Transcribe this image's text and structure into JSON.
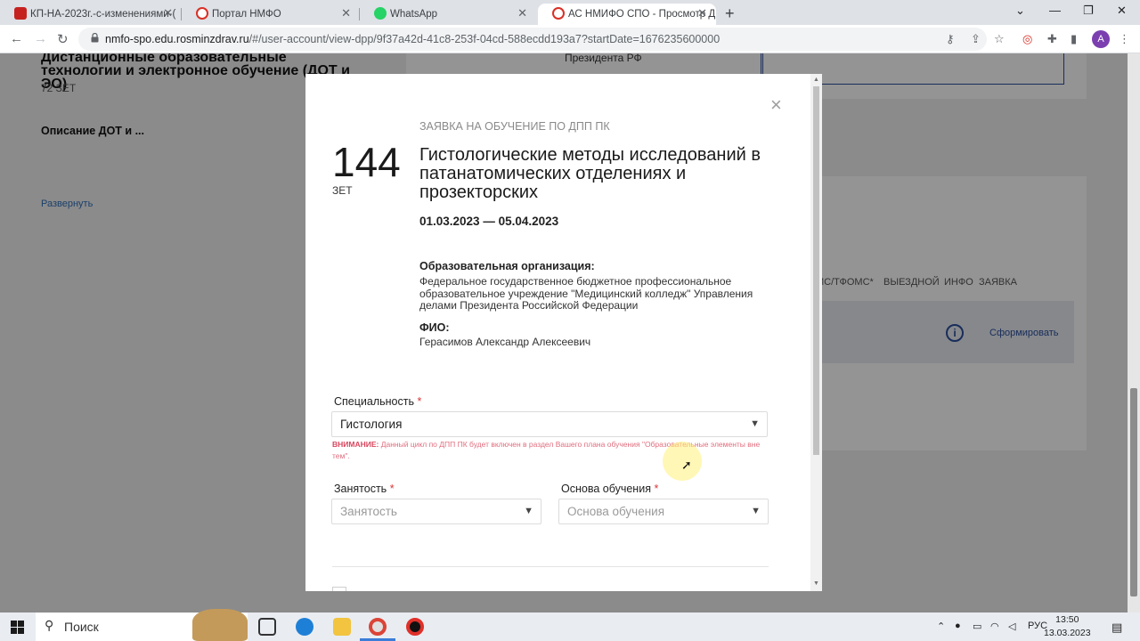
{
  "browser": {
    "tabs": [
      {
        "title": "КП-НА-2023г.-с-изменениями-(",
        "fav_color": "#c5221f"
      },
      {
        "title": "Портал НМФО",
        "fav_color": "#d93025"
      },
      {
        "title": "WhatsApp",
        "fav_color": "#25d366"
      },
      {
        "title": "АС НМИФО СПО - Просмотр Д",
        "fav_color": "#d93025"
      }
    ],
    "url_host": "nmfo-spo.edu.rosminzdrav.ru",
    "url_path": "/#/user-account/view-dpp/9f37a42d-41c8-253f-04cd-588ecdd193a7?startDate=1676235600000",
    "avatar_letter": "A"
  },
  "background": {
    "dot_title": "Дистанционные образовательные технологии и электронное обучение (ДОТ и ЭО)",
    "dot_zet": "72 ЗЕТ",
    "dot_desc": "Описание ДОТ и ...",
    "expand": "Развернуть",
    "president": "Президента РФ",
    "cols": [
      "МС/ТФОМС*",
      "ВЫЕЗДНОЙ",
      "ИНФО",
      "ЗАЯВКА"
    ],
    "form_button": "Сформировать"
  },
  "modal": {
    "kicker": "ЗАЯВКА НА ОБУЧЕНИЕ ПО ДПП ПК",
    "hours": "144",
    "hours_unit": "ЗЕТ",
    "title": "Гистологические методы исследований в патанатомических отделениях и прозекторских",
    "dates": "01.03.2023 — 05.04.2023",
    "org_label": "Образовательная организация:",
    "org_value": "Федеральное государственное бюджетное профессиональное образовательное учреждение \"Медицинский колледж\" Управления делами Президента Российской Федерации",
    "fio_label": "ФИО:",
    "fio_value": "Герасимов Александр Алексеевич",
    "specialty_label": "Специальность",
    "specialty_value": "Гистология",
    "warning_head": "ВНИМАНИЕ:",
    "warning_text": "Данный цикл по ДПП ПК будет включен в раздел Вашего плана обучения \"Образовательные элементы вне тем\".",
    "employment_label": "Занятость",
    "employment_placeholder": "Занятость",
    "basis_label": "Основа обучения",
    "basis_placeholder": "Основа обучения",
    "required_mark": "*"
  },
  "taskbar": {
    "search_placeholder": "Поиск",
    "lang": "РУС",
    "time": "13:50",
    "date": "13.03.2023"
  }
}
